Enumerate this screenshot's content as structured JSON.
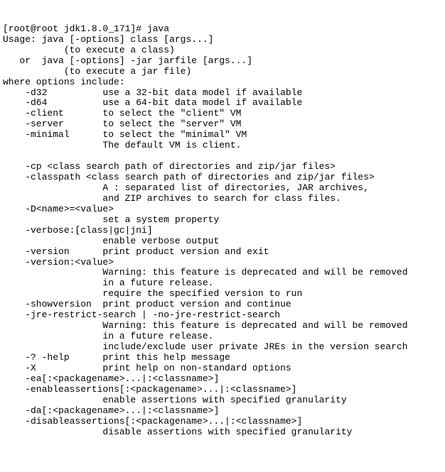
{
  "prompt": "[root@root jdk1.8.0_171]# java",
  "lines": [
    "Usage: java [-options] class [args...]",
    "           (to execute a class)",
    "   or  java [-options] -jar jarfile [args...]",
    "           (to execute a jar file)",
    "where options include:",
    "    -d32          use a 32-bit data model if available",
    "    -d64          use a 64-bit data model if available",
    "    -client       to select the \"client\" VM",
    "    -server       to select the \"server\" VM",
    "    -minimal      to select the \"minimal\" VM",
    "                  The default VM is client.",
    "",
    "    -cp <class search path of directories and zip/jar files>",
    "    -classpath <class search path of directories and zip/jar files>",
    "                  A : separated list of directories, JAR archives,",
    "                  and ZIP archives to search for class files.",
    "    -D<name>=<value>",
    "                  set a system property",
    "    -verbose:[class|gc|jni]",
    "                  enable verbose output",
    "    -version      print product version and exit",
    "    -version:<value>",
    "                  Warning: this feature is deprecated and will be removed",
    "                  in a future release.",
    "                  require the specified version to run",
    "    -showversion  print product version and continue",
    "    -jre-restrict-search | -no-jre-restrict-search",
    "                  Warning: this feature is deprecated and will be removed",
    "                  in a future release.",
    "                  include/exclude user private JREs in the version search",
    "    -? -help      print this help message",
    "    -X            print help on non-standard options",
    "    -ea[:<packagename>...|:<classname>]",
    "    -enableassertions[:<packagename>...|:<classname>]",
    "                  enable assertions with specified granularity",
    "    -da[:<packagename>...|:<classname>]",
    "    -disableassertions[:<packagename>...|:<classname>]",
    "                  disable assertions with specified granularity"
  ]
}
